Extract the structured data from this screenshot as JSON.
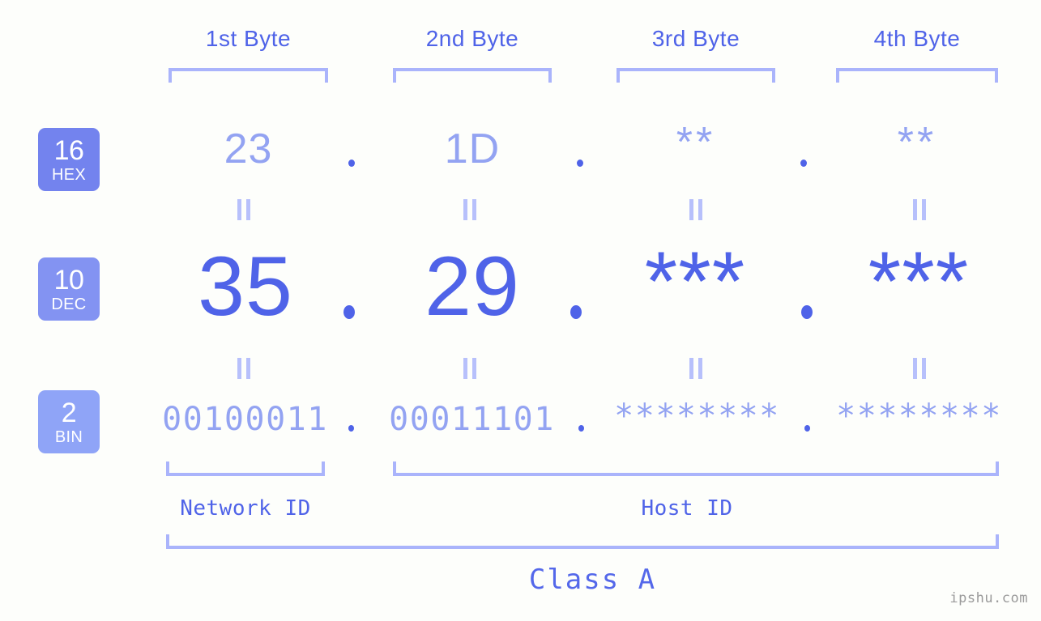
{
  "watermark": "ipshu.com",
  "byte_headers": [
    {
      "label": "1st Byte"
    },
    {
      "label": "2nd Byte"
    },
    {
      "label": "3rd Byte"
    },
    {
      "label": "4th Byte"
    }
  ],
  "bases": [
    {
      "num": "16",
      "name": "HEX"
    },
    {
      "num": "10",
      "name": "DEC"
    },
    {
      "num": "2",
      "name": "BIN"
    }
  ],
  "rows": {
    "hex": {
      "values": [
        "23",
        "1D",
        "**",
        "**"
      ]
    },
    "dec": {
      "values": [
        "35",
        "29",
        "***",
        "***"
      ]
    },
    "bin": {
      "values": [
        "00100011",
        "00011101",
        "********",
        "********"
      ]
    }
  },
  "separator": ".",
  "equals_mark": "=",
  "sections": [
    {
      "label": "Network ID"
    },
    {
      "label": "Host ID"
    }
  ],
  "class_label": "Class A",
  "colors": {
    "background": "#fdfefb",
    "accent_strong": "#4f63e8",
    "accent_light": "#93a3f2",
    "bracket": "#aab4fb",
    "badge_hex": "#7383ee",
    "badge_dec": "#8393f2",
    "badge_bin": "#8fa4f7",
    "watermark": "#9b9b9b"
  }
}
